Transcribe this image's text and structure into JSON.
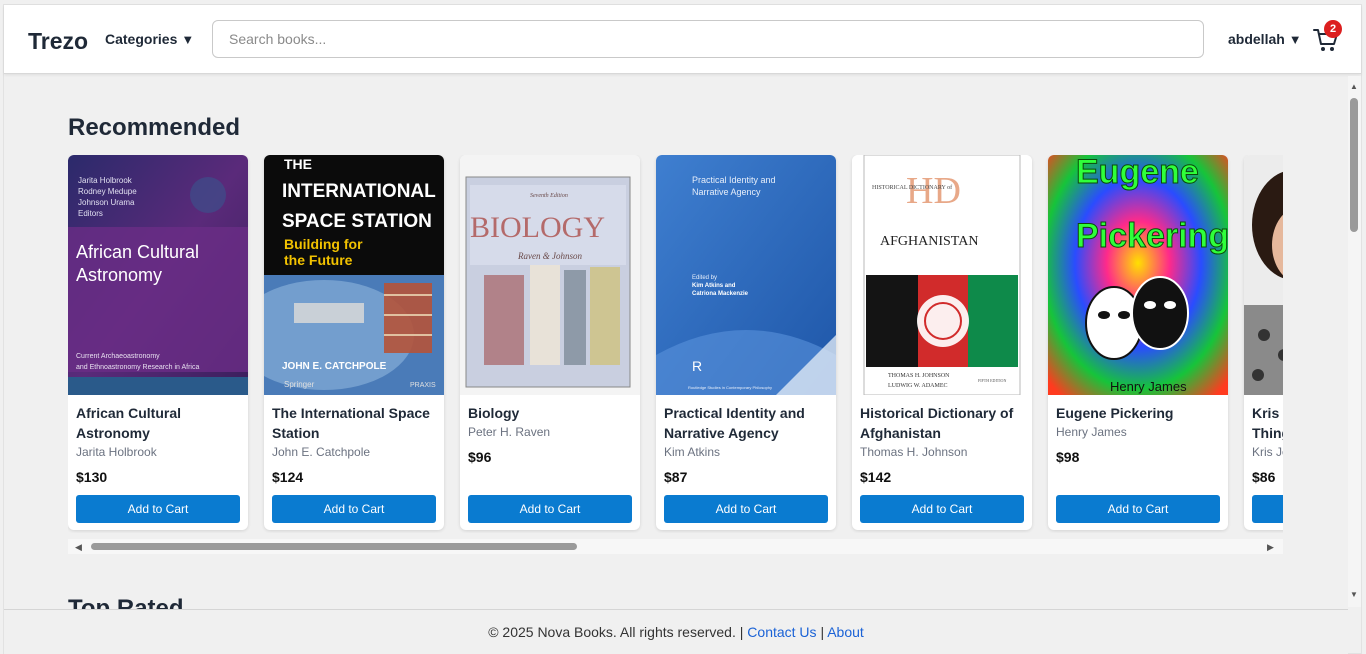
{
  "header": {
    "logo": "Trezo",
    "categories_label": "Categories",
    "search_placeholder": "Search books...",
    "user_name": "abdellah",
    "cart_count": "2"
  },
  "sections": {
    "recommended_title": "Recommended",
    "next_title": "Top Rated"
  },
  "books": [
    {
      "title": "African Cultural Astronomy",
      "author": "Jarita Holbrook",
      "price": "$130",
      "cover_lines": [
        "Jarita Holbrook",
        "Rodney Medupe",
        "Johnson Urama",
        "Editors",
        "African Cultural",
        "Astronomy",
        "Current Archaeoastronomy",
        "and Ethnoastronomy Research in Africa"
      ]
    },
    {
      "title": "The International Space Station",
      "author": "John E. Catchpole",
      "price": "$124",
      "cover_lines": [
        "THE",
        "INTERNATIONAL",
        "SPACE STATION",
        "Building for",
        "the Future",
        "JOHN E. CATCHPOLE",
        "Springer",
        "PRAXIS"
      ]
    },
    {
      "title": "Biology",
      "author": "Peter H. Raven",
      "price": "$96",
      "cover_lines": [
        "Seventh Edition",
        "BIOLOGY",
        "Raven & Johnson"
      ]
    },
    {
      "title": "Practical Identity and Narrative Agency",
      "author": "Kim Atkins",
      "price": "$87",
      "cover_lines": [
        "Practical Identity and",
        "Narrative Agency",
        "Edited by",
        "Kim Atkins and",
        "Catriona Mackenzie",
        "Routledge Studies in Contemporary Philosophy"
      ]
    },
    {
      "title": "Historical Dictionary of Afghanistan",
      "author": "Thomas H. Johnson",
      "price": "$142",
      "cover_lines": [
        "HISTORICAL DICTIONARY of",
        "AFGHANISTAN",
        "THOMAS H. JOHNSON",
        "LUDWIG W. ADAMEC",
        "FIFTH EDITION"
      ]
    },
    {
      "title": "Eugene Pickering",
      "author": "Henry James",
      "price": "$98",
      "cover_lines": [
        "Eugene",
        "Pickering",
        "Henry James"
      ]
    },
    {
      "title": "Kris Jenner... And All Things Kardashian",
      "author": "Kris Jenner",
      "price": "$86",
      "cover_lines": []
    }
  ],
  "add_to_cart_label": "Add to Cart",
  "footer": {
    "copyright": "© 2025 Nova Books. All rights reserved.",
    "separator": "|",
    "contact": "Contact Us",
    "about": "About"
  },
  "colors": {
    "accent": "#0a7bd0",
    "badge": "#dc1f1f",
    "link": "#1a62d6"
  },
  "icons": [
    "chevron-down-icon",
    "cart-icon",
    "scroll-left-icon",
    "scroll-right-icon",
    "scroll-up-icon",
    "scroll-down-icon"
  ]
}
